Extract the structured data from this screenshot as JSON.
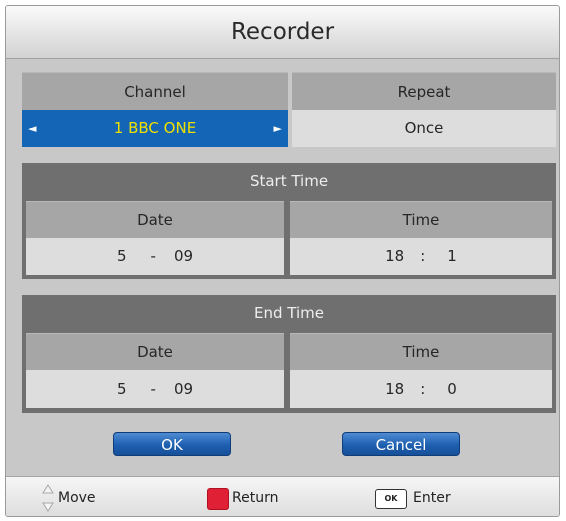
{
  "dialog": {
    "title": "Recorder"
  },
  "channel": {
    "label": "Channel",
    "value": "1 BBC ONE",
    "left_arrow": "◄",
    "right_arrow": "►"
  },
  "repeat": {
    "label": "Repeat",
    "value": "Once"
  },
  "start_time": {
    "title": "Start Time",
    "date_label": "Date",
    "time_label": "Time",
    "date_day": "5",
    "date_sep": "-",
    "date_month": "09",
    "time_hour": "18",
    "time_sep": ":",
    "time_min": "1"
  },
  "end_time": {
    "title": "End Time",
    "date_label": "Date",
    "time_label": "Time",
    "date_day": "5",
    "date_sep": "-",
    "date_month": "09",
    "time_hour": "18",
    "time_sep": ":",
    "time_min": "0"
  },
  "buttons": {
    "ok": "OK",
    "cancel": "Cancel"
  },
  "footer": {
    "move": "Move",
    "return": "Return",
    "ok_key": "OK",
    "enter": "Enter"
  },
  "colors": {
    "selected_bg": "#1465b5",
    "selected_text": "#f0e000",
    "return_key": "#e02035",
    "button_blue": "#1d5fb0"
  }
}
